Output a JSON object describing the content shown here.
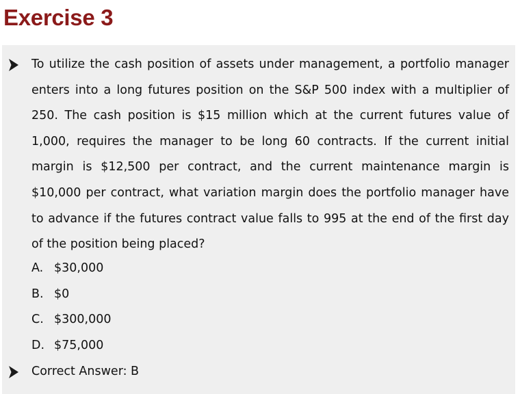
{
  "slide": {
    "title": "Exercise 3"
  },
  "question": {
    "text": "To utilize the cash position of assets under management, a portfolio manager enters into a long futures position on the S&P 500 index with a multiplier of 250. The cash position is $15 million which at the current futures value of 1,000, requires the manager to be long 60 contracts. If the current initial margin is $12,500 per contract, and the current maintenance margin is $10,000 per contract, what variation margin does the portfolio manager have to advance if the futures contract value falls to 995 at the end of the first day of the position being placed?"
  },
  "options": [
    {
      "letter": "A.",
      "value": "$30,000"
    },
    {
      "letter": "B.",
      "value": "$0"
    },
    {
      "letter": "C.",
      "value": "$300,000"
    },
    {
      "letter": "D.",
      "value": "$75,000"
    }
  ],
  "answer": {
    "text": "Correct Answer: B"
  },
  "icons": {
    "bullet": "arrow-bullet-icon"
  }
}
